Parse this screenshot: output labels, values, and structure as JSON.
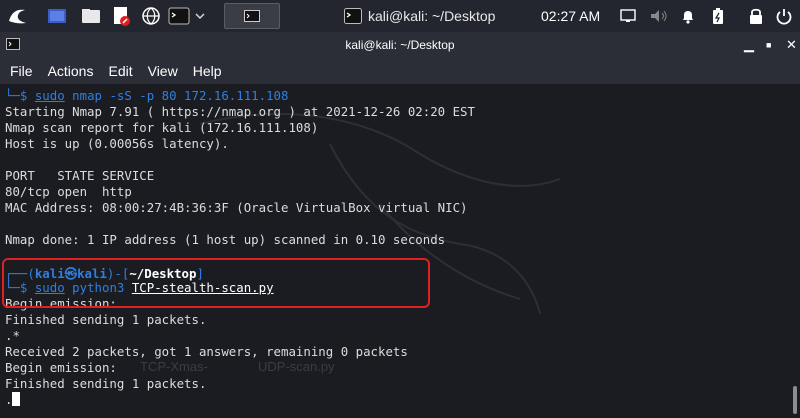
{
  "taskbar": {
    "active_task_title": "kali@kali: ~/Desktop",
    "clock": "02:27 AM",
    "icons": [
      "kali-menu-icon",
      "workspace-icon",
      "file-manager-icon",
      "text-editor-icon",
      "browser-icon",
      "terminal-icon",
      "dropdown-icon",
      "terminal-task-icon",
      "monitor-icon",
      "volume-icon",
      "notification-icon",
      "battery-icon",
      "lock-icon",
      "power-icon"
    ]
  },
  "window": {
    "title": "kali@kali: ~/Desktop",
    "controls": [
      "minimize",
      "maximize",
      "close"
    ]
  },
  "menu": {
    "file": "File",
    "actions": "Actions",
    "edit": "Edit",
    "view": "View",
    "help": "Help"
  },
  "terminal": {
    "l1": {
      "prefix": "└─$ ",
      "sudo": "sudo",
      "cmd": " nmap -sS -p 80 172.16.111.108"
    },
    "l2": "Starting Nmap 7.91 ( https://nmap.org ) at 2021-12-26 02:20 EST",
    "l3": "Nmap scan report for kali (172.16.111.108)",
    "l4": "Host is up (0.00056s latency).",
    "l5": "PORT   STATE SERVICE",
    "l6": "80/tcp open  http",
    "l7": "MAC Address: 08:00:27:4B:36:3F (Oracle VirtualBox virtual NIC)",
    "l8": "Nmap done: 1 IP address (1 host up) scanned in 0.10 seconds",
    "p_open": "┌──(",
    "p_user": "kali㉿kali",
    "p_mid": ")-[",
    "p_dir": "~/Desktop",
    "p_close": "]",
    "l10": {
      "prefix": "└─$ ",
      "sudo": "sudo",
      "python": " python3 ",
      "script": "TCP-stealth-scan.py"
    },
    "l11": "Begin emission:",
    "l12": "Finished sending 1 packets.",
    "l13": ".*",
    "l14": "Received 2 packets, got 1 answers, remaining 0 packets",
    "l15": "Begin emission:",
    "l16": "Finished sending 1 packets.",
    "l17": ".",
    "watermark_1": "TCP-Xmas-",
    "watermark_2": "UDP-scan.py"
  },
  "colors": {
    "terminal_bg": "#1a1c22",
    "prompt_blue": "#2f7fe0",
    "highlight_red": "#e02020"
  }
}
